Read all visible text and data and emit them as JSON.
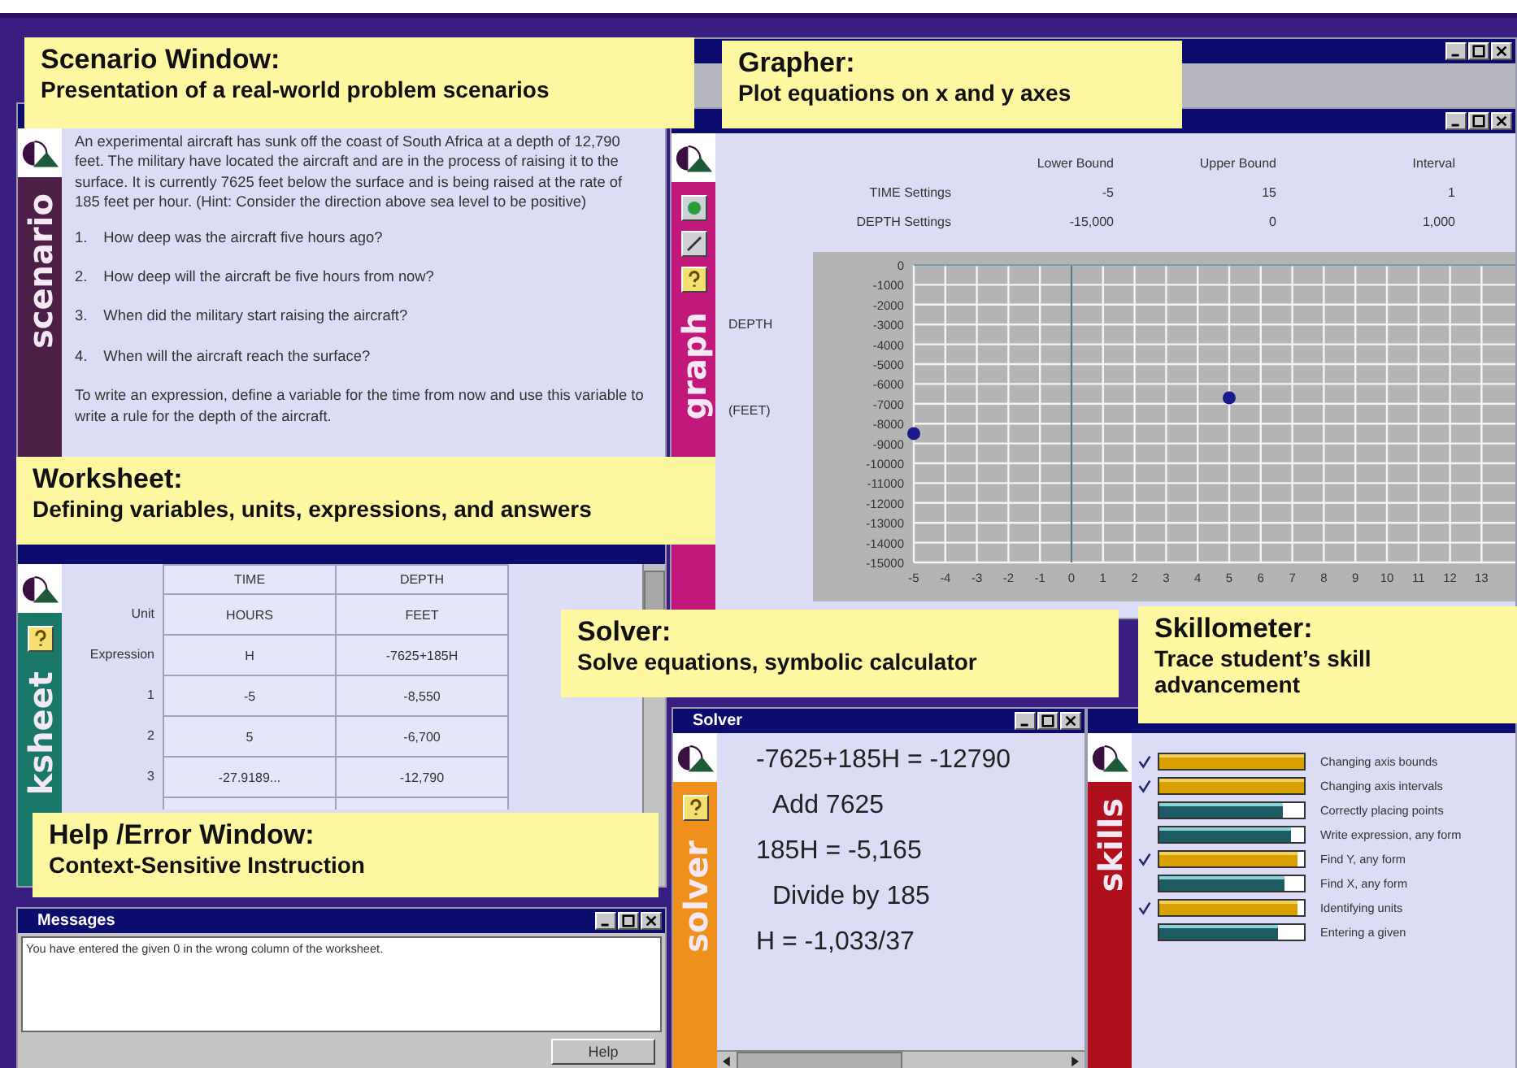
{
  "callouts": [
    {
      "title": "Scenario Window:",
      "subtitle": "Presentation of a real-world problem scenarios"
    },
    {
      "title": "Grapher:",
      "subtitle": "Plot equations on x and y axes"
    },
    {
      "title": "Worksheet:",
      "subtitle": "Defining variables, units, expressions, and answers"
    },
    {
      "title": "Solver:",
      "subtitle": "Solve equations, symbolic calculator"
    },
    {
      "title": "Skillometer:",
      "subtitle": "Trace student’s skill advancement"
    },
    {
      "title": "Help /Error Window:",
      "subtitle": "Context-Sensitive Instruction"
    }
  ],
  "scenario": {
    "tab": "scenario",
    "text": "An experimental aircraft has sunk off the coast of South Africa at a depth of 12,790 feet.  The military have located the aircraft and are in the process of raising it to the surface.  It is currently 7625 feet below the surface and is being raised at the rate of 185 feet per hour. (Hint: Consider the direction above sea level to be positive)",
    "questions": [
      {
        "number": "1.",
        "text": "How deep was the aircraft five hours ago?"
      },
      {
        "number": "2.",
        "text": "How deep will the aircraft be five hours from now?"
      },
      {
        "number": "3.",
        "text": "When did the military start raising the aircraft?"
      },
      {
        "number": "4.",
        "text": "When will the aircraft reach the surface?"
      }
    ],
    "instruction": "To write an expression, define a variable for the time from now and use this variable to write a rule for the depth of the aircraft."
  },
  "grapher": {
    "tab": "graph",
    "columns": [
      "Lower Bound",
      "Upper Bound",
      "Interval"
    ],
    "settings": [
      {
        "label": "TIME Settings",
        "values": [
          "-5",
          "15",
          "1"
        ]
      },
      {
        "label": "DEPTH Settings",
        "values": [
          "-15,000",
          "0",
          "1,000"
        ]
      }
    ],
    "axis_labels": [
      "DEPTH",
      "(FEET)"
    ],
    "chart_data": {
      "type": "scatter",
      "grid": true,
      "ref_lines": [
        {
          "axis": "x",
          "value": 0
        }
      ],
      "x": [
        -5,
        5
      ],
      "series": [
        {
          "color": "#1a1a8c",
          "values": [
            -8500,
            -6700
          ]
        }
      ],
      "xlim": [
        -5,
        14.1
      ],
      "ylim": [
        -15000,
        0
      ],
      "xticks": [
        -5,
        -4,
        -3,
        -2,
        -1,
        0,
        1,
        2,
        3,
        4,
        5,
        6,
        7,
        8,
        9,
        10,
        11,
        12,
        13
      ],
      "yticks": [
        0,
        -1000,
        -2000,
        -3000,
        -4000,
        -5000,
        -6000,
        -7000,
        -8000,
        -9000,
        -10000,
        -11000,
        -12000,
        -13000,
        -14000,
        -15000
      ]
    }
  },
  "worksheet": {
    "tab": "ksheet",
    "columns": [
      "TIME",
      "DEPTH"
    ],
    "rows": [
      {
        "label": "Unit",
        "cells": [
          "HOURS",
          "FEET"
        ]
      },
      {
        "label": "Expression",
        "cells": [
          "H",
          "-7625+185H"
        ]
      },
      {
        "label": "1",
        "cells": [
          "-5",
          "-8,550"
        ]
      },
      {
        "label": "2",
        "cells": [
          "5",
          "-6,700"
        ]
      },
      {
        "label": "3",
        "cells": [
          "-27.9189...",
          "-12,790"
        ]
      }
    ]
  },
  "solver": {
    "title": "Solver",
    "tab": "solver",
    "steps": [
      {
        "kind": "equation",
        "text": "-7625+185H = -12790"
      },
      {
        "kind": "operation",
        "text": "Add 7625"
      },
      {
        "kind": "equation",
        "text": "185H = -5,165"
      },
      {
        "kind": "operation",
        "text": "Divide by 185"
      },
      {
        "kind": "equation",
        "text": "H = -1,033/37"
      }
    ]
  },
  "skillometer": {
    "tab": "skills",
    "skills": [
      {
        "name": "Changing axis bounds",
        "checked": true,
        "level": 1
      },
      {
        "name": "Changing axis intervals",
        "checked": true,
        "level": 1
      },
      {
        "name": "Correctly placing points",
        "checked": false,
        "level": 0.85
      },
      {
        "name": "Write expression, any form",
        "checked": false,
        "level": 0.91
      },
      {
        "name": "Find Y, any form",
        "checked": true,
        "level": 0.96
      },
      {
        "name": "Find X, any form",
        "checked": false,
        "level": 0.87
      },
      {
        "name": "Identifying units",
        "checked": true,
        "level": 0.95
      },
      {
        "name": "Entering a given",
        "checked": false,
        "level": 0.82
      }
    ]
  },
  "messages": {
    "title": "Messages",
    "text": "You have entered the given 0 in the wrong column of the worksheet.",
    "button": "Help"
  }
}
